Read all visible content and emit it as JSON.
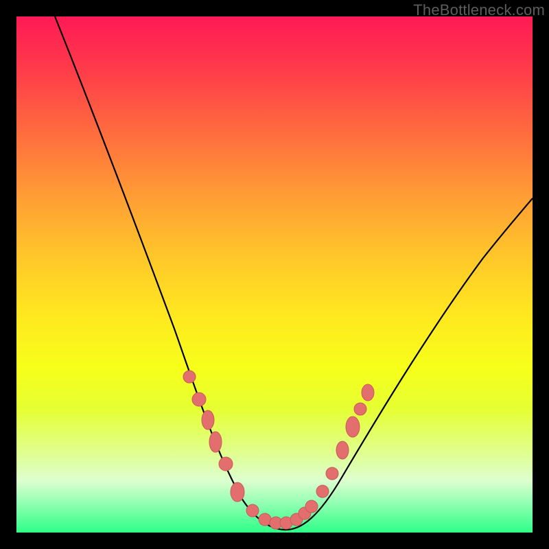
{
  "watermark": "TheBottleneck.com",
  "colors": {
    "accent_dot": "#e36e6e",
    "dot_stroke": "#c95a5a",
    "curve": "#000000",
    "frame_bg": "#000000"
  },
  "chart_data": {
    "type": "line",
    "title": "",
    "xlabel": "",
    "ylabel": "",
    "xlim": [
      0,
      100
    ],
    "ylim": [
      0,
      100
    ],
    "grid": false,
    "legend": false,
    "note": "Axes are unlabeled; values are estimated by pixel position on a 0–100 normalized scale. y increases upward (0 = bottom/green band).",
    "series": [
      {
        "name": "curve",
        "x": [
          8,
          12,
          16,
          20,
          24,
          28,
          31,
          33,
          35,
          37,
          39,
          41,
          43,
          45,
          47,
          49,
          51,
          53,
          55,
          58,
          62,
          66,
          70,
          74,
          78,
          82,
          86,
          90,
          94,
          98,
          100
        ],
        "y": [
          100,
          90,
          80,
          70,
          60,
          48,
          38,
          32,
          27,
          22,
          18,
          14,
          10,
          7,
          4,
          3,
          2,
          2,
          3,
          5,
          10,
          17,
          24,
          32,
          40,
          47,
          54,
          59,
          64,
          68,
          70
        ]
      },
      {
        "name": "dots_outline",
        "x": [
          33.5,
          35.5,
          37,
          38.5,
          40.5,
          43,
          45.5,
          48,
          50,
          52,
          54,
          55.5,
          57,
          59,
          61,
          63,
          65,
          66.5,
          68
        ],
        "y": [
          30,
          25.5,
          22,
          17.5,
          13.5,
          8,
          4.5,
          3,
          2.3,
          2.3,
          3,
          4,
          5.5,
          8.5,
          12,
          16.5,
          21,
          24.5,
          27.5
        ]
      }
    ]
  }
}
